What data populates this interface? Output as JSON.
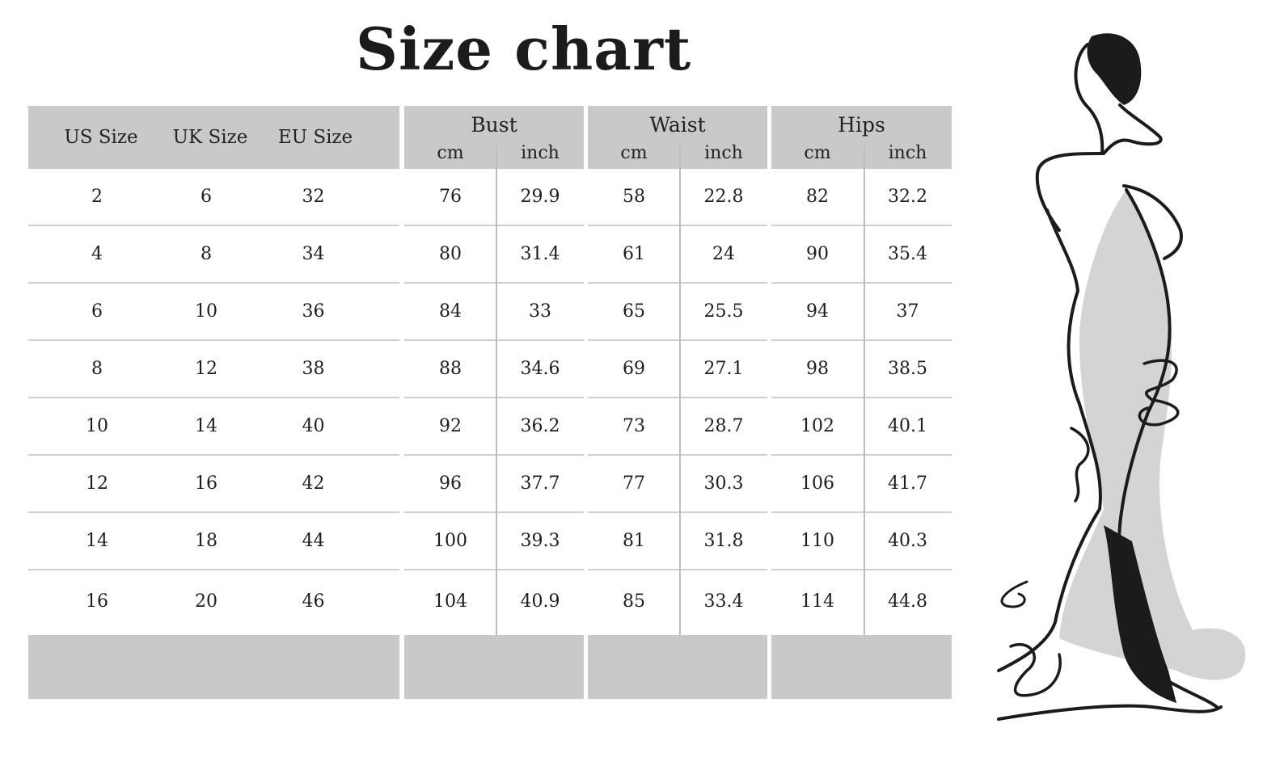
{
  "title": "Size chart",
  "size_block": {
    "headers": [
      "US Size",
      "UK Size",
      "EU Size"
    ],
    "rows": [
      [
        "2",
        "6",
        "32"
      ],
      [
        "4",
        "8",
        "34"
      ],
      [
        "6",
        "10",
        "36"
      ],
      [
        "8",
        "12",
        "38"
      ],
      [
        "10",
        "14",
        "40"
      ],
      [
        "12",
        "16",
        "42"
      ],
      [
        "14",
        "18",
        "44"
      ],
      [
        "16",
        "20",
        "46"
      ]
    ]
  },
  "bust": {
    "label": "Bust",
    "unit_cm": "cm",
    "unit_inch": "inch",
    "rows": [
      [
        "76",
        "29.9"
      ],
      [
        "80",
        "31.4"
      ],
      [
        "84",
        "33"
      ],
      [
        "88",
        "34.6"
      ],
      [
        "92",
        "36.2"
      ],
      [
        "96",
        "37.7"
      ],
      [
        "100",
        "39.3"
      ],
      [
        "104",
        "40.9"
      ]
    ]
  },
  "waist": {
    "label": "Waist",
    "unit_cm": "cm",
    "unit_inch": "inch",
    "rows": [
      [
        "58",
        "22.8"
      ],
      [
        "61",
        "24"
      ],
      [
        "65",
        "25.5"
      ],
      [
        "69",
        "27.1"
      ],
      [
        "73",
        "28.7"
      ],
      [
        "77",
        "30.3"
      ],
      [
        "81",
        "31.8"
      ],
      [
        "85",
        "33.4"
      ]
    ]
  },
  "hips": {
    "label": "Hips",
    "unit_cm": "cm",
    "unit_inch": "inch",
    "rows": [
      [
        "82",
        "32.2"
      ],
      [
        "90",
        "35.4"
      ],
      [
        "94",
        "37"
      ],
      [
        "98",
        "38.5"
      ],
      [
        "102",
        "40.1"
      ],
      [
        "106",
        "41.7"
      ],
      [
        "110",
        "40.3"
      ],
      [
        "114",
        "44.8"
      ]
    ]
  },
  "colors": {
    "header_bg": "#c9c9c9",
    "rule": "#cfcfcf",
    "text": "#1e1e1e"
  },
  "illustration": {
    "icon": "dress-figure-icon"
  }
}
